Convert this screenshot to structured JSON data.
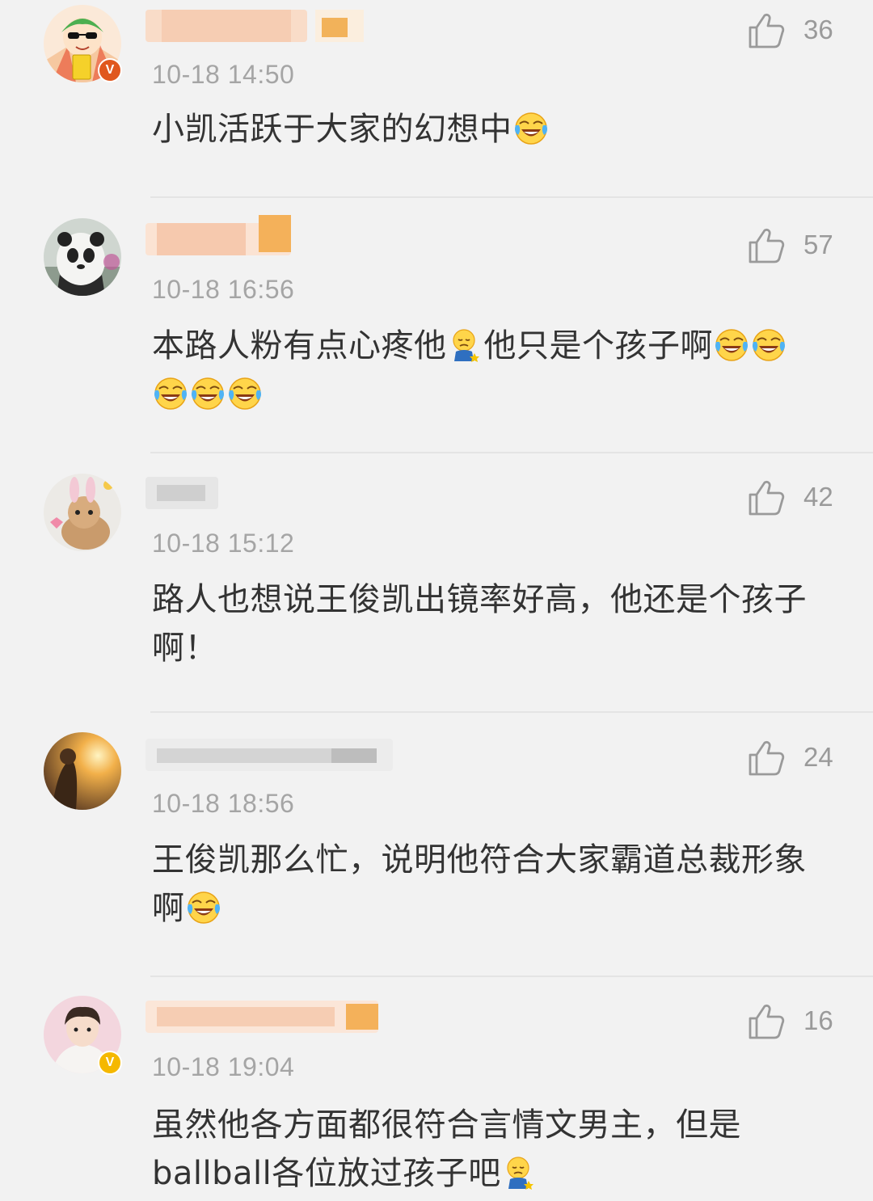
{
  "comments": [
    {
      "time": "10-18 14:50",
      "likes": "36",
      "text": [
        "小凯活跃于大家的幻想中"
      ],
      "emoji_after": [
        "laugh-cry-emoji"
      ],
      "verified": true,
      "verified_color": "#e0571e",
      "avatar": "cartoon-kid-icon"
    },
    {
      "time": "10-18 16:56",
      "likes": "57",
      "text_a": "本路人粉有点心疼他",
      "text_b": "他只是个孩子啊",
      "emojis": [
        "sad-emoji",
        "laugh-cry-emoji",
        "laugh-cry-emoji",
        "laugh-cry-emoji",
        "laugh-cry-emoji",
        "laugh-cry-emoji"
      ],
      "avatar": "panda-photo"
    },
    {
      "time": "10-18 15:12",
      "likes": "42",
      "text": "路人也想说王俊凯出镜率好高，他还是个孩子啊！",
      "avatar": "bunny-photo"
    },
    {
      "time": "10-18 18:56",
      "likes": "24",
      "text": "王俊凯那么忙，说明他符合大家霸道总裁形象啊",
      "emojis": [
        "laugh-cry-emoji"
      ],
      "avatar": "sunset-photo"
    },
    {
      "time": "10-18 19:04",
      "likes": "16",
      "text": "虽然他各方面都很符合言情文男主，但是ballball各位放过孩子吧",
      "emojis": [
        "sad-emoji"
      ],
      "verified": true,
      "verified_color": "#f5b800",
      "avatar": "boy-photo"
    }
  ],
  "colors": {
    "background": "#f2f2f2",
    "text": "#333333",
    "meta": "#a5a5a5",
    "divider": "#e4e4e4"
  },
  "icons": {
    "like": "thumbs-up-icon"
  }
}
